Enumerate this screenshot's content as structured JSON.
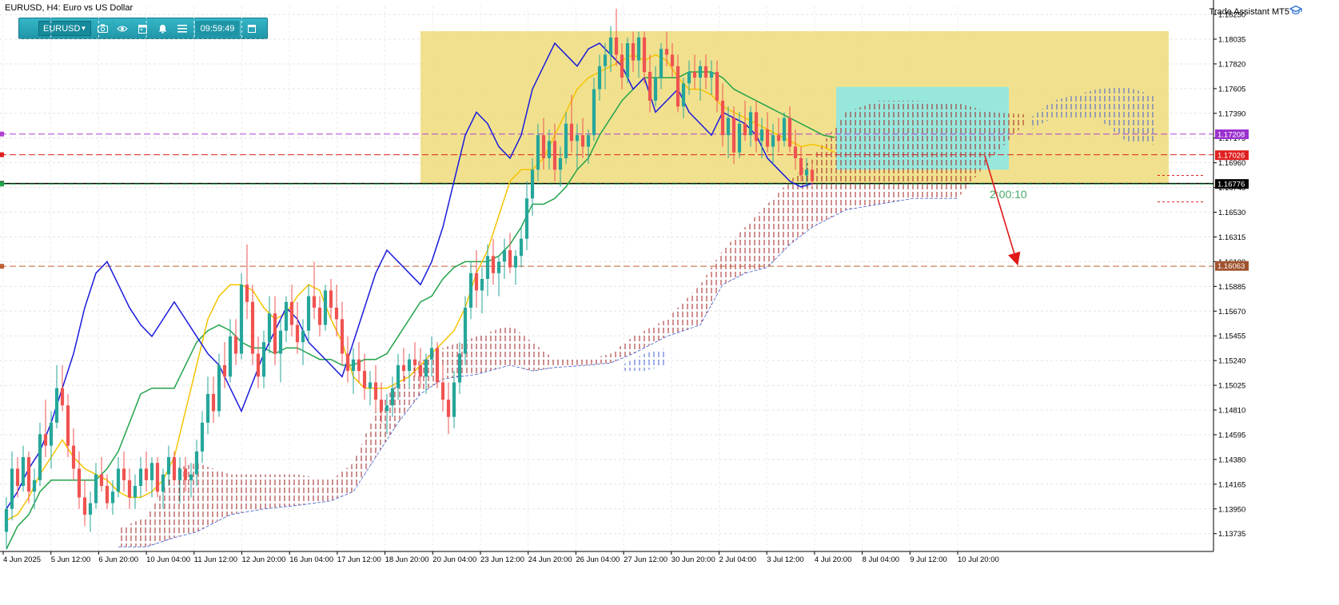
{
  "window": {
    "title": "EURUSD, H4:  Euro vs US Dollar",
    "assistant_label": "Trade Assistant MT5",
    "assistant_icon": "graduation-cap-icon"
  },
  "toolbar": {
    "symbol": "EURUSD",
    "timer": "09:59:49",
    "icons": [
      "camera-icon",
      "eye-icon",
      "calendar-icon",
      "bell-icon",
      "menu-icon",
      "window-icon"
    ]
  },
  "countdown": "2:00:10",
  "colors": {
    "background": "#ffffff",
    "bull_candle": "#26a69a",
    "bear_candle": "#ef5350",
    "tenkan": "#f5c400",
    "kijun": "#22a34a",
    "chikou": "#1a1adc",
    "kumo_bear": "#a02020",
    "kumo_bull": "#4060d0",
    "zone_yellow": "#eedc7a",
    "zone_cyan": "#8ee8e4"
  },
  "chart_data": {
    "type": "candlestick",
    "symbol": "EURUSD",
    "timeframe": "H4",
    "ylim": [
      1.1358,
      1.1832
    ],
    "y_ticks": [
      "1.18250",
      "1.18035",
      "1.17820",
      "1.17605",
      "1.17390",
      "1.17175",
      "1.16960",
      "1.16745",
      "1.16530",
      "1.16315",
      "1.16100",
      "1.15885",
      "1.15670",
      "1.15455",
      "1.15240",
      "1.15025",
      "1.14810",
      "1.14595",
      "1.14380",
      "1.14165",
      "1.13950",
      "1.13735"
    ],
    "x_ticks": [
      "4 Jun 2025",
      "5 Jun 12:00",
      "6 Jun 20:00",
      "10 Jun 04:00",
      "11 Jun 12:00",
      "12 Jun 20:00",
      "16 Jun 04:00",
      "17 Jun 12:00",
      "18 Jun 20:00",
      "20 Jun 04:00",
      "23 Jun 12:00",
      "24 Jun 20:00",
      "26 Jun 04:00",
      "27 Jun 12:00",
      "30 Jun 20:00",
      "2 Jul 04:00",
      "3 Jul 12:00",
      "4 Jul 20:00",
      "8 Jul 04:00",
      "9 Jul 12:00",
      "10 Jul 20:00"
    ],
    "price_labels": [
      {
        "value": 1.17208,
        "text": "1.17208",
        "color": "#9b30d0"
      },
      {
        "value": 1.17026,
        "text": "1.17026",
        "color": "#e02020"
      },
      {
        "value": 1.16776,
        "text": "1.16776",
        "color": "#000000"
      },
      {
        "value": 1.16063,
        "text": "1.16063",
        "color": "#a0522d"
      }
    ],
    "levels": [
      {
        "value": 1.1721,
        "color": "#b040d0",
        "style": "dashed"
      },
      {
        "value": 1.1703,
        "color": "#e02020",
        "style": "dashed"
      },
      {
        "value": 1.1678,
        "color": "#000000",
        "style": "solid"
      },
      {
        "value": 1.16775,
        "color": "#22a34a",
        "style": "dashed"
      },
      {
        "value": 1.1606,
        "color": "#c06030",
        "style": "dashed"
      }
    ],
    "candles": [
      [
        1.1375,
        1.1405,
        1.136,
        1.1395
      ],
      [
        1.1395,
        1.1445,
        1.1385,
        1.143
      ],
      [
        1.143,
        1.144,
        1.1405,
        1.1415
      ],
      [
        1.1415,
        1.145,
        1.141,
        1.144
      ],
      [
        1.144,
        1.1445,
        1.14,
        1.141
      ],
      [
        1.141,
        1.143,
        1.1395,
        1.142
      ],
      [
        1.142,
        1.147,
        1.1415,
        1.146
      ],
      [
        1.146,
        1.149,
        1.144,
        1.145
      ],
      [
        1.145,
        1.148,
        1.143,
        1.147
      ],
      [
        1.147,
        1.152,
        1.1465,
        1.15
      ],
      [
        1.15,
        1.152,
        1.148,
        1.1485
      ],
      [
        1.1485,
        1.1495,
        1.144,
        1.145
      ],
      [
        1.145,
        1.1465,
        1.142,
        1.143
      ],
      [
        1.143,
        1.1445,
        1.1395,
        1.1405
      ],
      [
        1.1405,
        1.142,
        1.138,
        1.139
      ],
      [
        1.139,
        1.141,
        1.1375,
        1.14
      ],
      [
        1.14,
        1.1435,
        1.1395,
        1.1425
      ],
      [
        1.1425,
        1.144,
        1.141,
        1.1415
      ],
      [
        1.1415,
        1.1425,
        1.1395,
        1.14
      ],
      [
        1.14,
        1.142,
        1.139,
        1.141
      ],
      [
        1.141,
        1.144,
        1.1405,
        1.143
      ],
      [
        1.143,
        1.1445,
        1.141,
        1.142
      ],
      [
        1.142,
        1.143,
        1.1395,
        1.1405
      ],
      [
        1.1405,
        1.1425,
        1.1395,
        1.1415
      ],
      [
        1.1415,
        1.144,
        1.1405,
        1.143
      ],
      [
        1.143,
        1.1445,
        1.141,
        1.142
      ],
      [
        1.142,
        1.144,
        1.1405,
        1.1435
      ],
      [
        1.1435,
        1.144,
        1.1405,
        1.141
      ],
      [
        1.141,
        1.143,
        1.1395,
        1.1425
      ],
      [
        1.1425,
        1.145,
        1.1415,
        1.144
      ],
      [
        1.144,
        1.1445,
        1.1415,
        1.142
      ],
      [
        1.142,
        1.144,
        1.14,
        1.143
      ],
      [
        1.143,
        1.144,
        1.141,
        1.142
      ],
      [
        1.142,
        1.1435,
        1.1405,
        1.1425
      ],
      [
        1.1425,
        1.1455,
        1.1415,
        1.1445
      ],
      [
        1.1445,
        1.148,
        1.1435,
        1.147
      ],
      [
        1.147,
        1.151,
        1.146,
        1.1495
      ],
      [
        1.1495,
        1.151,
        1.147,
        1.148
      ],
      [
        1.148,
        1.153,
        1.1475,
        1.152
      ],
      [
        1.152,
        1.154,
        1.15,
        1.151
      ],
      [
        1.151,
        1.156,
        1.1505,
        1.1545
      ],
      [
        1.1545,
        1.156,
        1.152,
        1.153
      ],
      [
        1.153,
        1.16,
        1.1525,
        1.159
      ],
      [
        1.159,
        1.1625,
        1.156,
        1.1575
      ],
      [
        1.1575,
        1.159,
        1.152,
        1.153
      ],
      [
        1.153,
        1.1545,
        1.15,
        1.151
      ],
      [
        1.151,
        1.155,
        1.15,
        1.154
      ],
      [
        1.154,
        1.158,
        1.153,
        1.1565
      ],
      [
        1.1565,
        1.158,
        1.152,
        1.153
      ],
      [
        1.153,
        1.156,
        1.1505,
        1.155
      ],
      [
        1.155,
        1.158,
        1.154,
        1.1575
      ],
      [
        1.1575,
        1.159,
        1.1545,
        1.1555
      ],
      [
        1.1555,
        1.1575,
        1.153,
        1.154
      ],
      [
        1.154,
        1.156,
        1.152,
        1.155
      ],
      [
        1.155,
        1.159,
        1.154,
        1.158
      ],
      [
        1.158,
        1.161,
        1.156,
        1.157
      ],
      [
        1.157,
        1.158,
        1.1545,
        1.1555
      ],
      [
        1.1555,
        1.159,
        1.155,
        1.1585
      ],
      [
        1.1585,
        1.1595,
        1.156,
        1.157
      ],
      [
        1.157,
        1.159,
        1.1545,
        1.156
      ],
      [
        1.156,
        1.1575,
        1.152,
        1.153
      ],
      [
        1.153,
        1.1545,
        1.1505,
        1.1515
      ],
      [
        1.1515,
        1.1535,
        1.1495,
        1.1525
      ],
      [
        1.1525,
        1.154,
        1.1505,
        1.1515
      ],
      [
        1.1515,
        1.153,
        1.149,
        1.15
      ],
      [
        1.15,
        1.1515,
        1.1485,
        1.1505
      ],
      [
        1.1505,
        1.152,
        1.148,
        1.149
      ],
      [
        1.149,
        1.1505,
        1.147,
        1.148
      ],
      [
        1.148,
        1.1495,
        1.146,
        1.1485
      ],
      [
        1.1485,
        1.151,
        1.1475,
        1.15
      ],
      [
        1.15,
        1.153,
        1.149,
        1.152
      ],
      [
        1.152,
        1.1535,
        1.1505,
        1.1515
      ],
      [
        1.1515,
        1.153,
        1.15,
        1.1525
      ],
      [
        1.1525,
        1.154,
        1.151,
        1.152
      ],
      [
        1.152,
        1.1535,
        1.15,
        1.151
      ],
      [
        1.151,
        1.153,
        1.1495,
        1.1525
      ],
      [
        1.1525,
        1.1545,
        1.151,
        1.1535
      ],
      [
        1.1535,
        1.154,
        1.15,
        1.1505
      ],
      [
        1.1505,
        1.152,
        1.148,
        1.149
      ],
      [
        1.149,
        1.1505,
        1.146,
        1.1475
      ],
      [
        1.1475,
        1.1515,
        1.1465,
        1.1505
      ],
      [
        1.1505,
        1.154,
        1.1495,
        1.153
      ],
      [
        1.153,
        1.158,
        1.152,
        1.157
      ],
      [
        1.157,
        1.161,
        1.156,
        1.16
      ],
      [
        1.16,
        1.162,
        1.157,
        1.1585
      ],
      [
        1.1585,
        1.1605,
        1.1565,
        1.1595
      ],
      [
        1.1595,
        1.1625,
        1.158,
        1.1615
      ],
      [
        1.1615,
        1.163,
        1.159,
        1.16
      ],
      [
        1.16,
        1.1615,
        1.158,
        1.161
      ],
      [
        1.161,
        1.163,
        1.1595,
        1.162
      ],
      [
        1.162,
        1.1635,
        1.16,
        1.1605
      ],
      [
        1.1605,
        1.162,
        1.159,
        1.1615
      ],
      [
        1.1615,
        1.164,
        1.1605,
        1.163
      ],
      [
        1.163,
        1.168,
        1.162,
        1.1665
      ],
      [
        1.1665,
        1.17,
        1.165,
        1.169
      ],
      [
        1.169,
        1.173,
        1.168,
        1.172
      ],
      [
        1.172,
        1.1735,
        1.169,
        1.17
      ],
      [
        1.17,
        1.1725,
        1.169,
        1.1715
      ],
      [
        1.1715,
        1.173,
        1.168,
        1.169
      ],
      [
        1.169,
        1.171,
        1.1675,
        1.17
      ],
      [
        1.17,
        1.174,
        1.1695,
        1.173
      ],
      [
        1.173,
        1.1755,
        1.1705,
        1.1715
      ],
      [
        1.1715,
        1.173,
        1.169,
        1.172
      ],
      [
        1.172,
        1.1735,
        1.17,
        1.171
      ],
      [
        1.171,
        1.1725,
        1.1695,
        1.172
      ],
      [
        1.172,
        1.177,
        1.1715,
        1.176
      ],
      [
        1.176,
        1.179,
        1.175,
        1.178
      ],
      [
        1.178,
        1.18,
        1.176,
        1.179
      ],
      [
        1.179,
        1.1815,
        1.1775,
        1.1805
      ],
      [
        1.1805,
        1.183,
        1.178,
        1.179
      ],
      [
        1.179,
        1.18,
        1.176,
        1.177
      ],
      [
        1.177,
        1.1805,
        1.1765,
        1.18
      ],
      [
        1.18,
        1.181,
        1.1775,
        1.1785
      ],
      [
        1.1785,
        1.181,
        1.177,
        1.1805
      ],
      [
        1.1805,
        1.181,
        1.1765,
        1.1775
      ],
      [
        1.1775,
        1.179,
        1.174,
        1.175
      ],
      [
        1.175,
        1.178,
        1.1745,
        1.177
      ],
      [
        1.177,
        1.18,
        1.176,
        1.1795
      ],
      [
        1.1795,
        1.181,
        1.178,
        1.179
      ],
      [
        1.179,
        1.18,
        1.177,
        1.178
      ],
      [
        1.178,
        1.179,
        1.174,
        1.1745
      ],
      [
        1.1745,
        1.177,
        1.1735,
        1.1765
      ],
      [
        1.1765,
        1.1785,
        1.1755,
        1.1775
      ],
      [
        1.1775,
        1.179,
        1.176,
        1.177
      ],
      [
        1.177,
        1.1785,
        1.175,
        1.178
      ],
      [
        1.178,
        1.179,
        1.176,
        1.177
      ],
      [
        1.177,
        1.1785,
        1.1755,
        1.1775
      ],
      [
        1.1775,
        1.1785,
        1.174,
        1.175
      ],
      [
        1.175,
        1.1765,
        1.171,
        1.172
      ],
      [
        1.172,
        1.1745,
        1.17,
        1.1735
      ],
      [
        1.1735,
        1.1745,
        1.1695,
        1.1705
      ],
      [
        1.1705,
        1.174,
        1.17,
        1.173
      ],
      [
        1.173,
        1.175,
        1.1715,
        1.172
      ],
      [
        1.172,
        1.1745,
        1.171,
        1.174
      ],
      [
        1.174,
        1.175,
        1.1705,
        1.1715
      ],
      [
        1.1715,
        1.1735,
        1.17,
        1.1725
      ],
      [
        1.1725,
        1.174,
        1.1705,
        1.171
      ],
      [
        1.171,
        1.173,
        1.1695,
        1.172
      ],
      [
        1.172,
        1.1735,
        1.1705,
        1.1715
      ],
      [
        1.1715,
        1.174,
        1.171,
        1.1735
      ],
      [
        1.1735,
        1.1745,
        1.1705,
        1.171
      ],
      [
        1.171,
        1.1725,
        1.169,
        1.17
      ],
      [
        1.17,
        1.171,
        1.168,
        1.1685
      ],
      [
        1.1685,
        1.17,
        1.1675,
        1.169
      ],
      [
        1.169,
        1.1695,
        1.1675,
        1.168
      ]
    ],
    "tenkan": [
      1.1385,
      1.139,
      1.1405,
      1.1425,
      1.144,
      1.1455,
      1.144,
      1.143,
      1.1425,
      1.142,
      1.141,
      1.1405,
      1.1405,
      1.141,
      1.142,
      1.144,
      1.148,
      1.152,
      1.156,
      1.158,
      1.159,
      1.159,
      1.1585,
      1.157,
      1.156,
      1.1565,
      1.158,
      1.159,
      1.1585,
      1.156,
      1.154,
      1.151,
      1.15,
      1.15,
      1.15,
      1.1505,
      1.151,
      1.152,
      1.153,
      1.154,
      1.155,
      1.157,
      1.16,
      1.162,
      1.165,
      1.168,
      1.169,
      1.169,
      1.17,
      1.172,
      1.174,
      1.176,
      1.177,
      1.1775,
      1.178,
      1.1785,
      1.179,
      1.1785,
      1.179,
      1.1785,
      1.177,
      1.176,
      1.176,
      1.1755,
      1.1745,
      1.174,
      1.1735,
      1.173,
      1.1725,
      1.172,
      1.1715,
      1.171,
      1.1712,
      1.171,
      1.1705
    ],
    "kijun": [
      1.136,
      1.138,
      1.139,
      1.141,
      1.142,
      1.142,
      1.142,
      1.142,
      1.142,
      1.143,
      1.1445,
      1.147,
      1.1495,
      1.15,
      1.15,
      1.15,
      1.152,
      1.154,
      1.155,
      1.1555,
      1.155,
      1.154,
      1.1535,
      1.1535,
      1.153,
      1.1535,
      1.1535,
      1.153,
      1.1525,
      1.1525,
      1.152,
      1.152,
      1.1525,
      1.1525,
      1.153,
      1.1545,
      1.156,
      1.1575,
      1.158,
      1.1595,
      1.1605,
      1.161,
      1.161,
      1.161,
      1.1615,
      1.1625,
      1.164,
      1.166,
      1.166,
      1.1665,
      1.1675,
      1.169,
      1.17,
      1.172,
      1.1735,
      1.175,
      1.176,
      1.177,
      1.177,
      1.177,
      1.177,
      1.1775,
      1.1775,
      1.1775,
      1.177,
      1.176,
      1.1755,
      1.175,
      1.1745,
      1.174,
      1.1735,
      1.173,
      1.1725,
      1.172,
      1.1718
    ],
    "chikou": [
      1.1395,
      1.141,
      1.143,
      1.1445,
      1.147,
      1.15,
      1.153,
      1.157,
      1.16,
      1.161,
      1.159,
      1.157,
      1.1555,
      1.1545,
      1.156,
      1.1575,
      1.156,
      1.1545,
      1.153,
      1.152,
      1.15,
      1.148,
      1.1505,
      1.153,
      1.155,
      1.157,
      1.156,
      1.154,
      1.153,
      1.152,
      1.151,
      1.154,
      1.157,
      1.16,
      1.162,
      1.161,
      1.16,
      1.159,
      1.161,
      1.164,
      1.168,
      1.172,
      1.174,
      1.173,
      1.171,
      1.17,
      1.172,
      1.176,
      1.178,
      1.18,
      1.179,
      1.178,
      1.1795,
      1.18,
      1.179,
      1.178,
      1.176,
      1.177,
      1.174,
      1.175,
      1.176,
      1.174,
      1.173,
      1.172,
      1.174,
      1.1735,
      1.173,
      1.172,
      1.17,
      1.169,
      1.168,
      1.1675,
      1.1678
    ]
  }
}
